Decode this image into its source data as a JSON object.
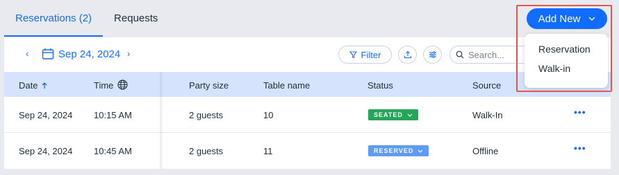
{
  "tabs": [
    {
      "label": "Reservations (2)",
      "active": true
    },
    {
      "label": "Requests",
      "active": false
    }
  ],
  "toolbar": {
    "prev_icon": "chevron-left-icon",
    "next_icon": "chevron-right-icon",
    "date": "Sep 24, 2024",
    "filter_label": "Filter",
    "search_placeholder": "Search..."
  },
  "table": {
    "headers": [
      "Date",
      "Time",
      "Party size",
      "Table name",
      "Status",
      "Source"
    ],
    "rows": [
      {
        "date": "Sep 24, 2024",
        "time": "10:15 AM",
        "party": "2 guests",
        "table": "10",
        "status": "SEATED",
        "source": "Walk-In"
      },
      {
        "date": "Sep 24, 2024",
        "time": "10:45 AM",
        "party": "2 guests",
        "table": "11",
        "status": "RESERVED",
        "source": "Offline"
      }
    ]
  },
  "add_new": {
    "label": "Add New",
    "options": [
      "Reservation",
      "Walk-in"
    ]
  },
  "colors": {
    "accent": "#116dff",
    "seated": "#25a55a",
    "reserved": "#5f9bf5",
    "highlight": "#e8564a",
    "header_bg": "#d5e3fc"
  }
}
